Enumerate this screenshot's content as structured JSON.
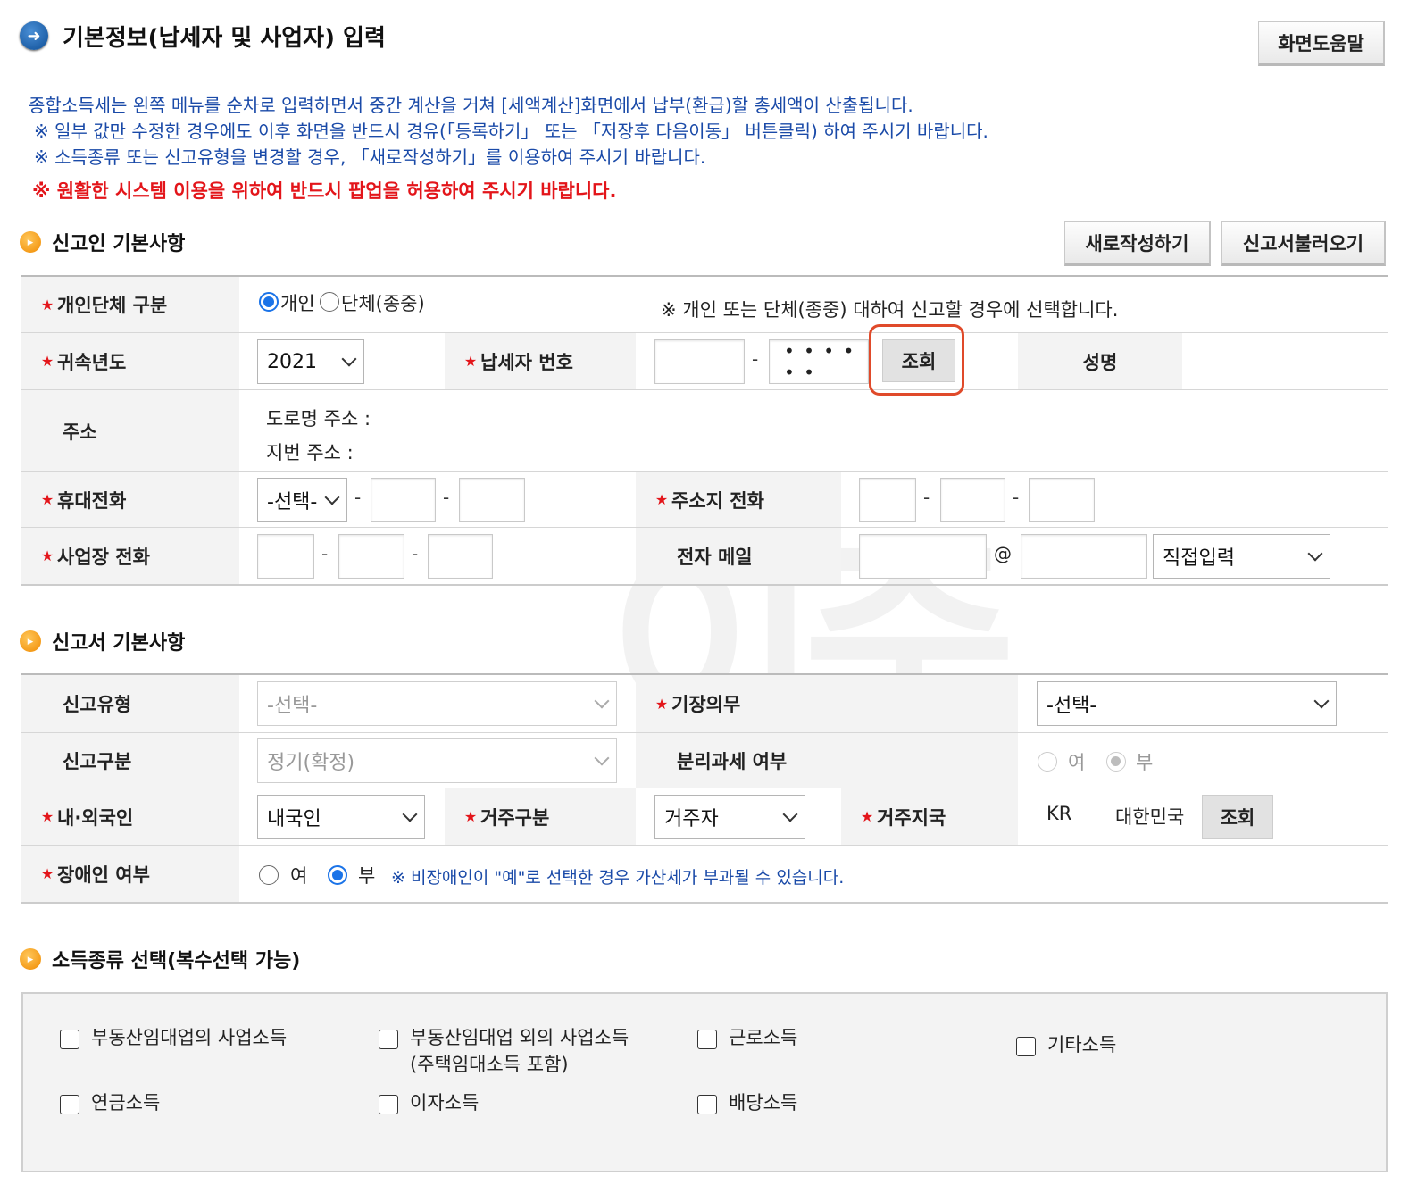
{
  "header": {
    "title": "기본정보(납세자 및 사업자) 입력",
    "help_button": "화면도움말"
  },
  "notices": [
    "종합소득세는 왼쪽 메뉴를 순차로 입력하면서 중간 계산을 거쳐 [세액계산]화면에서 납부(환급)할 총세액이 산출됩니다.",
    "※ 일부 값만 수정한 경우에도 이후 화면을 반드시 경유(「등록하기」 또는 「저장후 다음이동」 버튼클릭) 하여 주시기 바랍니다.",
    "※ 소득종류 또는 신고유형을 변경할 경우, 「새로작성하기」를 이용하여 주시기 바랍니다."
  ],
  "notice_red": "※ 원활한 시스템 이용을 위하여 반드시 팝업을 허용하여 주시기 바랍니다.",
  "reporter": {
    "section_title": "신고인 기본사항",
    "new_button": "새로작성하기",
    "load_button": "신고서불러오기",
    "entity_label": "개인단체 구분",
    "entity_individual": "개인",
    "entity_group": "단체(종중)",
    "entity_note": "※ 개인 또는 단체(종중) 대하여 신고할 경우에 선택합니다.",
    "year_label": "귀속년도",
    "year_value": "2021",
    "taxpayer_no_label": "납세자 번호",
    "taxpayer_no_masked": "• • • • • •",
    "lookup_button": "조회",
    "name_label": "성명",
    "address_label": "주소",
    "road_address": "도로명 주소 :",
    "lot_address": "지번 주소 :",
    "mobile_label": "휴대전화",
    "mobile_select": "-선택-",
    "home_phone_label": "주소지 전화",
    "biz_phone_label": "사업장 전화",
    "email_label": "전자 메일",
    "email_at": "@",
    "email_domain_select": "직접입력",
    "dash": "-"
  },
  "report": {
    "section_title": "신고서 기본사항",
    "type_label": "신고유형",
    "type_value": "-선택-",
    "bookkeeping_label": "기장의무",
    "bookkeeping_value": "-선택-",
    "category_label": "신고구분",
    "category_value": "정기(확정)",
    "separate_tax_label": "분리과세 여부",
    "yes": "여",
    "no": "부",
    "nationality_label": "내·외국인",
    "nationality_value": "내국인",
    "residence_label": "거주구분",
    "residence_value": "거주자",
    "country_label": "거주지국",
    "country_code": "KR",
    "country_name": "대한민국",
    "country_lookup": "조회",
    "disability_label": "장애인 여부",
    "disability_note": "※ 비장애인이 \"예\"로 선택한 경우 가산세가 부과될 수 있습니다."
  },
  "income": {
    "section_title": "소득종류 선택(복수선택 가능)",
    "items": [
      "부동산임대업의 사업소득",
      "부동산임대업 외의 사업소득",
      "(주택임대소득 포함)",
      "근로소득",
      "기타소득",
      "연금소득",
      "이자소득",
      "배당소득"
    ]
  },
  "colors": {
    "notice_blue": "#1a4aa8",
    "notice_red": "#e3151a",
    "required_star": "#e3151a",
    "highlight": "#e04a2a",
    "radio_selected": "#1a73e8"
  },
  "icons": {
    "title": "arrow-right-circle-icon",
    "section": "arrow-right-circle-icon",
    "select": "chevron-down-icon"
  }
}
